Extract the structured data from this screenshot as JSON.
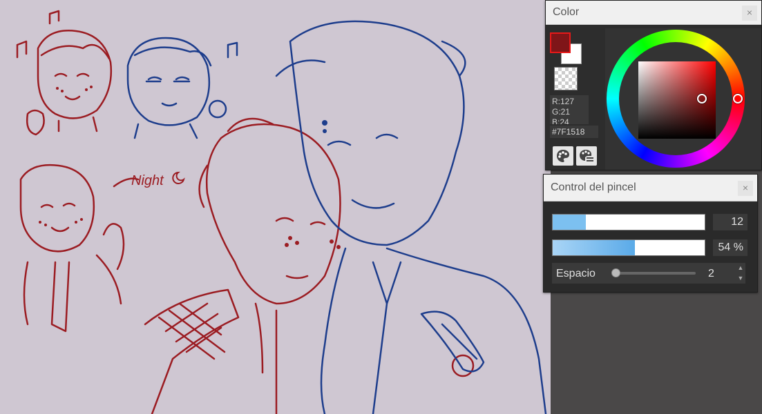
{
  "color_panel": {
    "title": "Color",
    "close_label": "×",
    "foreground_color": "#7F1518",
    "background_color": "#FFFFFF",
    "rgb_r": "R:127",
    "rgb_g": "G:21",
    "rgb_b": "B:24",
    "hex": "#7F1518",
    "tools": [
      "palette-icon",
      "palette-settings-icon"
    ]
  },
  "brush_panel": {
    "title": "Control del pincel",
    "close_label": "×",
    "size_value": "12",
    "size_fraction": 0.22,
    "opacity_value": "54 %",
    "opacity_fraction": 0.54,
    "spacing_label": "Espacio",
    "spacing_value": "2"
  },
  "canvas_text": {
    "night_label": "Night"
  },
  "colors": {
    "canvas_bg": "#cfc7d2",
    "red_stroke": "#9b1c22",
    "blue_stroke": "#1d3d8c",
    "slider_blue": "#7cc0f0"
  }
}
